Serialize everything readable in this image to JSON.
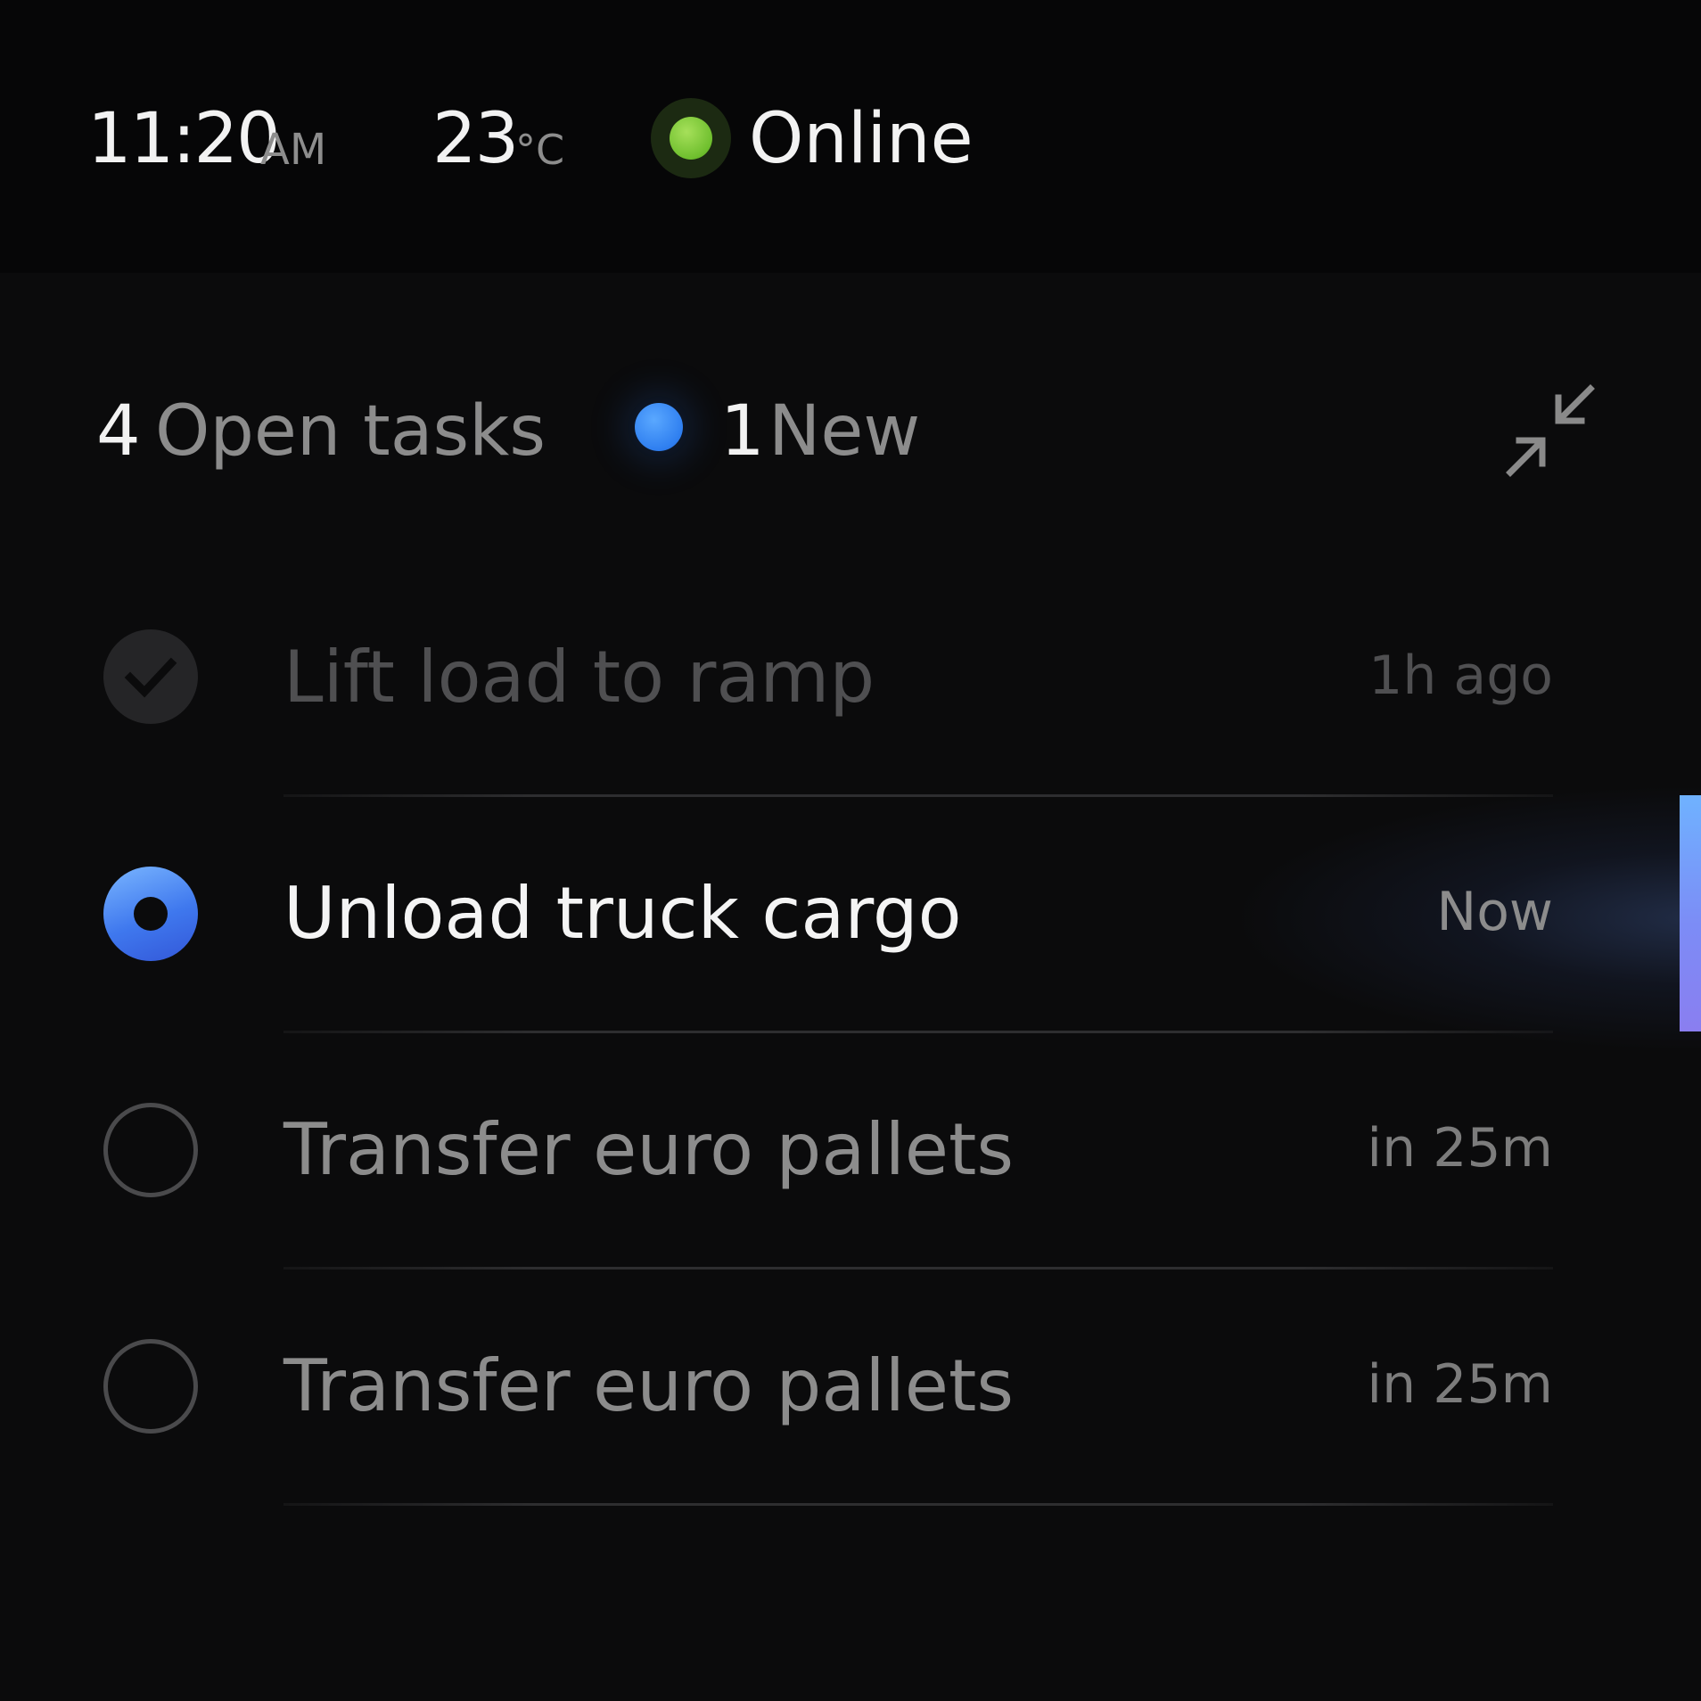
{
  "status_bar": {
    "time": "11:20",
    "ampm": "AM",
    "temperature": "23",
    "temperature_unit": "°C",
    "connection_status": "Online",
    "status_color": "#6fbf2e"
  },
  "header": {
    "open_count": "4",
    "open_label": "Open tasks",
    "new_count": "1",
    "new_label": "New",
    "new_color": "#2f7ff0",
    "collapse_icon": "collapse-arrows-icon"
  },
  "tasks": [
    {
      "title": "Lift load to ramp",
      "time": "1h ago",
      "state": "done"
    },
    {
      "title": "Unload truck cargo",
      "time": "Now",
      "state": "active"
    },
    {
      "title": "Transfer euro pallets",
      "time": "in 25m",
      "state": "pending"
    },
    {
      "title": "Transfer euro pallets",
      "time": "in 25m",
      "state": "pending"
    }
  ],
  "colors": {
    "background": "#0b0b0c",
    "text_primary": "#f2f2f2",
    "text_secondary": "#8c8c8c",
    "accent": "#3f78ee"
  }
}
